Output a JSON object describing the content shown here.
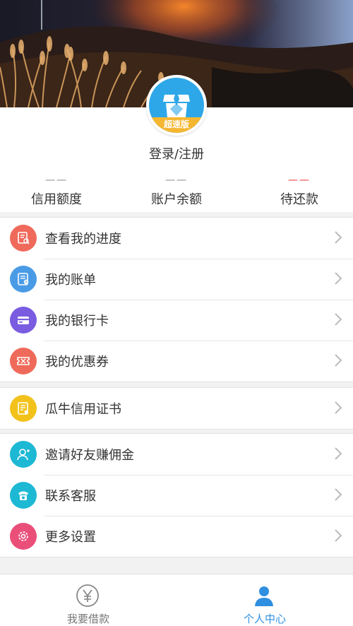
{
  "profile": {
    "avatar_badge": "超速版",
    "login_label": "登录/注册"
  },
  "stats": [
    {
      "value": "——",
      "label": "信用额度",
      "accent": "#888888"
    },
    {
      "value": "——",
      "label": "账户余额",
      "accent": "#888888"
    },
    {
      "value": "——",
      "label": "待还款",
      "accent": "#e8322e"
    }
  ],
  "menu_group_1": [
    {
      "label": "查看我的进度",
      "icon": "progress-doc-icon",
      "color": "#ef6a5b"
    },
    {
      "label": "我的账单",
      "icon": "bill-icon",
      "color": "#4a9be6"
    },
    {
      "label": "我的银行卡",
      "icon": "bank-card-icon",
      "color": "#7a5ce0"
    },
    {
      "label": "我的优惠券",
      "icon": "coupon-icon",
      "color": "#ef6a5b"
    }
  ],
  "menu_group_2": [
    {
      "label": "瓜牛信用证书",
      "icon": "certificate-icon",
      "color": "#f2c21b"
    }
  ],
  "menu_group_3": [
    {
      "label": "邀请好友赚佣金",
      "icon": "invite-friend-icon",
      "color": "#1db8d4"
    },
    {
      "label": "联系客服",
      "icon": "phone-icon",
      "color": "#1db8d4"
    },
    {
      "label": "更多设置",
      "icon": "settings-icon",
      "color": "#ea4f7a"
    }
  ],
  "tabbar": {
    "tabs": [
      {
        "label": "我要借款",
        "icon": "yen-coin-icon",
        "active": false,
        "color": "#777777"
      },
      {
        "label": "个人中心",
        "icon": "person-icon",
        "active": true,
        "color": "#2e8fe0"
      }
    ]
  }
}
